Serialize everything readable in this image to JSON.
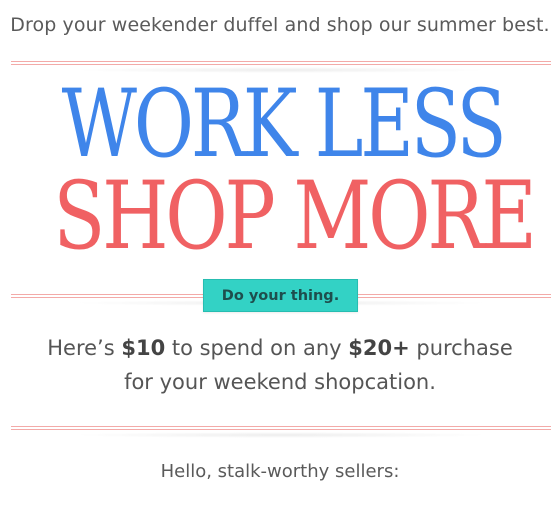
{
  "preheader": "Drop your weekender duffel and shop our summer best.",
  "hero": {
    "line1": "WORK LESS",
    "line2": "SHOP MORE",
    "line1_color": "#3f85ea",
    "line2_color": "#f06163"
  },
  "cta": {
    "label": "Do your thing.",
    "color": "#33d2c5"
  },
  "offer": {
    "part1": "Here’s ",
    "amount": "$10",
    "part2": " to spend on any ",
    "minimum": "$20+",
    "part3": " purchase",
    "line2": "for your weekend shopcation."
  },
  "greeting": "Hello, stalk-worthy sellers:",
  "divider_color": "#f3aaa8"
}
